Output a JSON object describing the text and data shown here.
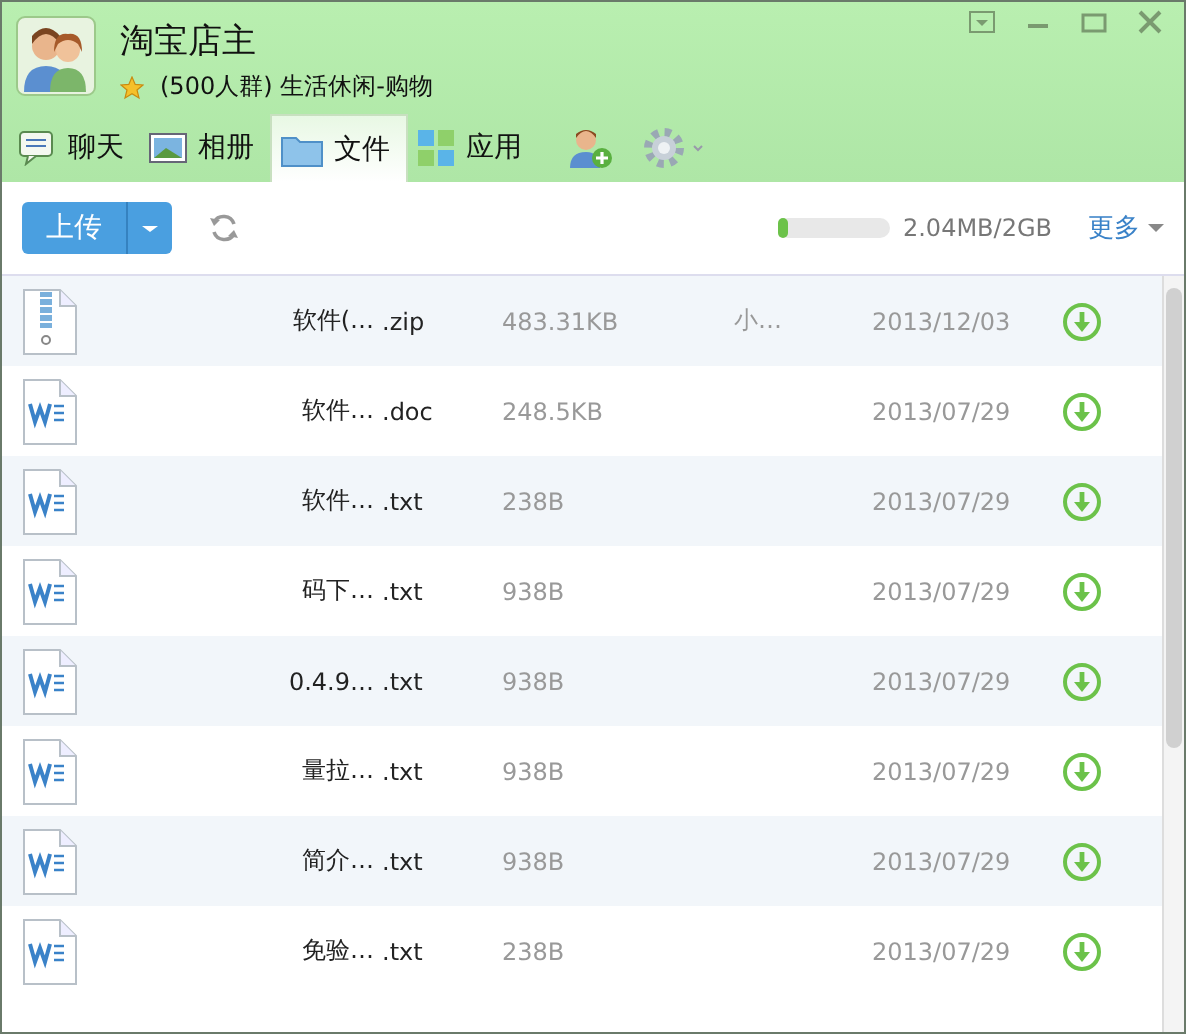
{
  "group": {
    "name": "淘宝店主",
    "info": "(500人群) 生活休闲-购物"
  },
  "tabs": [
    {
      "label": "聊天",
      "kind": "chat",
      "selected": false
    },
    {
      "label": "相册",
      "kind": "album",
      "selected": false
    },
    {
      "label": "文件",
      "kind": "folder",
      "selected": true
    },
    {
      "label": "应用",
      "kind": "apps",
      "selected": false
    }
  ],
  "toolbar": {
    "upload": "上传",
    "storage": {
      "level": 0.01,
      "reading": "2.04MB/2GB"
    },
    "more": "更多"
  },
  "files": [
    {
      "kind": "zip",
      "name": "软件(…",
      "ext": ".zip",
      "size": "483.31KB",
      "uploader": "小…",
      "date": "2013/12/03"
    },
    {
      "kind": "doc",
      "name": "软件…",
      "ext": ".doc",
      "size": "248.5KB",
      "date": "2013/07/29"
    },
    {
      "kind": "doc",
      "name": "软件…",
      "ext": ".txt",
      "size": "238B",
      "date": "2013/07/29"
    },
    {
      "kind": "doc",
      "name": "码下…",
      "ext": ".txt",
      "size": "938B",
      "date": "2013/07/29"
    },
    {
      "kind": "doc",
      "name": "0.4.9…",
      "ext": ".txt",
      "size": "938B",
      "date": "2013/07/29"
    },
    {
      "kind": "doc",
      "name": "量拉…",
      "ext": ".txt",
      "size": "938B",
      "date": "2013/07/29"
    },
    {
      "kind": "doc",
      "name": "简介…",
      "ext": ".txt",
      "size": "938B",
      "date": "2013/07/29"
    },
    {
      "kind": "doc",
      "name": "免验…",
      "ext": ".txt",
      "size": "238B",
      "date": "2013/07/29"
    }
  ]
}
